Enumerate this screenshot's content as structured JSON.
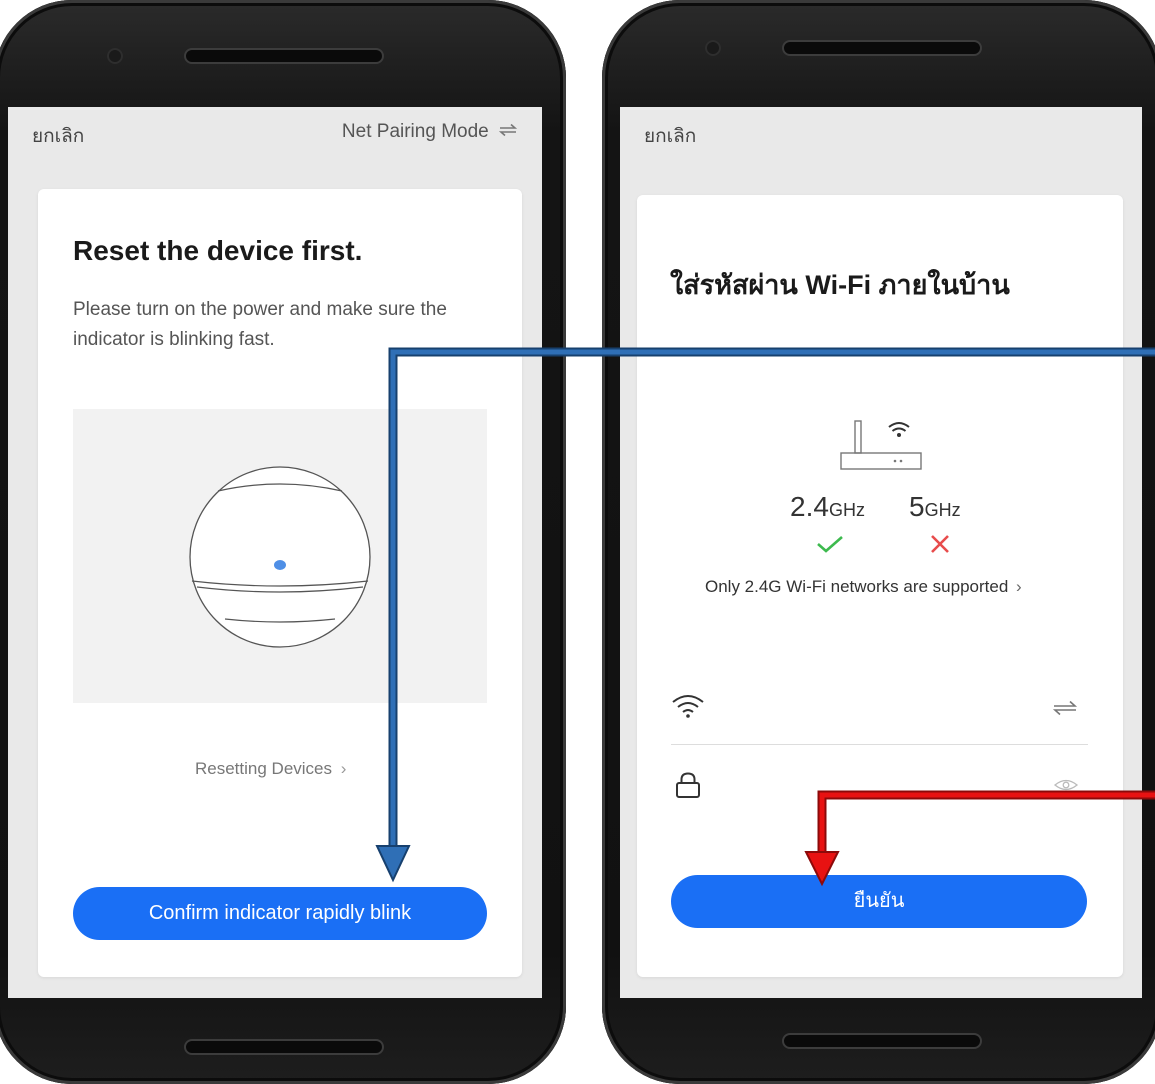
{
  "left_screen": {
    "cancel_label": "ยกเลิก",
    "mode_label": "Net Pairing Mode",
    "mode_icon": "swap-icon",
    "title": "Reset the device first.",
    "description": "Please turn on the power and make sure the indicator is blinking fast.",
    "reset_link": "Resetting Devices",
    "confirm_button": "Confirm indicator rapidly blink",
    "accent_color": "#1a6ff5"
  },
  "right_screen": {
    "cancel_label": "ยกเลิก",
    "title": "ใส่รหัสผ่าน Wi-Fi ภายในบ้าน",
    "band_24": "2.4",
    "band_24_unit": "GHz",
    "band_5": "5",
    "band_5_unit": "GHz",
    "supported_note": "Only 2.4G Wi-Fi networks are supported",
    "wifi_field_value": "",
    "password_field_value": "",
    "confirm_button": "ยืนยัน",
    "check_color": "#3dba4e",
    "cross_color": "#e84c4c"
  },
  "annotations": {
    "blue_arrow_color": "#1f5da8",
    "red_arrow_color": "#e81212"
  }
}
